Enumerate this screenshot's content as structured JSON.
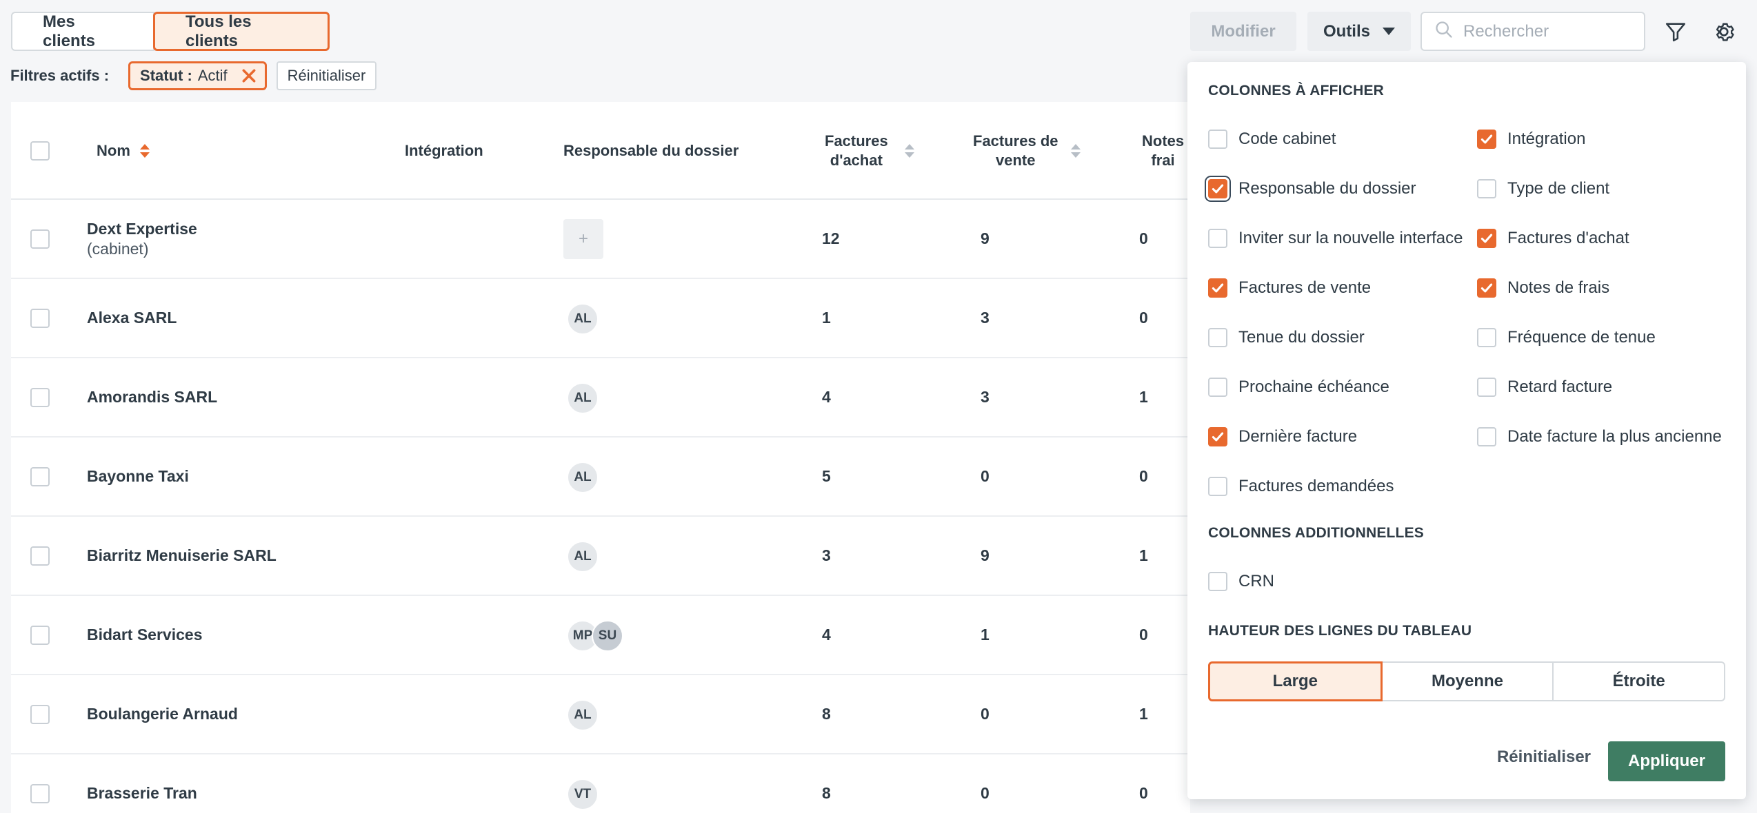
{
  "tabs": {
    "mine": "Mes clients",
    "all": "Tous les clients"
  },
  "toolbar": {
    "edit_label": "Modifier",
    "tools_label": "Outils",
    "search_placeholder": "Rechercher",
    "icons": [
      "search-icon",
      "filter-icon",
      "gear-icon",
      "chevron-down-icon"
    ]
  },
  "filters": {
    "label": "Filtres actifs :",
    "chip_key": "Statut :",
    "chip_value": "Actif",
    "reset_label": "Réinitialiser"
  },
  "table": {
    "headers": {
      "name": "Nom",
      "integration": "Intégration",
      "owner": "Responsable du dossier",
      "purchase_l1": "Factures",
      "purchase_l2": "d'achat",
      "sales_l1": "Factures de",
      "sales_l2": "vente",
      "expenses_l1": "Notes",
      "expenses_l2": "frai"
    },
    "rows": [
      {
        "name": "Dext Expertise",
        "sub": "(cabinet)",
        "avatars": [],
        "add_label": "+",
        "purchase": "12",
        "sales": "9",
        "expenses": "0"
      },
      {
        "name": "Alexa SARL",
        "avatars": [
          "AL"
        ],
        "purchase": "1",
        "sales": "3",
        "expenses": "0"
      },
      {
        "name": "Amorandis SARL",
        "avatars": [
          "AL"
        ],
        "purchase": "4",
        "sales": "3",
        "expenses": "1"
      },
      {
        "name": "Bayonne Taxi",
        "avatars": [
          "AL"
        ],
        "purchase": "5",
        "sales": "0",
        "expenses": "0"
      },
      {
        "name": "Biarritz Menuiserie SARL",
        "avatars": [
          "AL"
        ],
        "purchase": "3",
        "sales": "9",
        "expenses": "1"
      },
      {
        "name": "Bidart Services",
        "avatars": [
          "MP",
          "SU"
        ],
        "purchase": "4",
        "sales": "1",
        "expenses": "0"
      },
      {
        "name": "Boulangerie Arnaud",
        "avatars": [
          "AL"
        ],
        "purchase": "8",
        "sales": "0",
        "expenses": "1"
      },
      {
        "name": "Brasserie Tran",
        "avatars": [
          "VT"
        ],
        "purchase": "8",
        "sales": "0",
        "expenses": "0"
      }
    ]
  },
  "panel": {
    "columns_title": "COLONNES À AFFICHER",
    "columns": [
      {
        "label": "Code cabinet",
        "checked": false
      },
      {
        "label": "Intégration",
        "checked": true
      },
      {
        "label": "Responsable du dossier",
        "checked": true,
        "focused": true
      },
      {
        "label": "Type de client",
        "checked": false
      },
      {
        "label": "Inviter sur la nouvelle interface",
        "checked": false
      },
      {
        "label": "Factures d'achat",
        "checked": true
      },
      {
        "label": "Factures de vente",
        "checked": true
      },
      {
        "label": "Notes de frais",
        "checked": true
      },
      {
        "label": "Tenue du dossier",
        "checked": false
      },
      {
        "label": "Fréquence de tenue",
        "checked": false
      },
      {
        "label": "Prochaine échéance",
        "checked": false
      },
      {
        "label": "Retard facture",
        "checked": false
      },
      {
        "label": "Dernière facture",
        "checked": true
      },
      {
        "label": "Date facture la plus ancienne",
        "checked": false
      },
      {
        "label": "Factures demandées",
        "checked": false
      }
    ],
    "additional_title": "COLONNES ADDITIONNELLES",
    "additional": [
      {
        "label": "CRN",
        "checked": false
      }
    ],
    "height_title": "HAUTEUR DES LIGNES DU TABLEAU",
    "heights": [
      "Large",
      "Moyenne",
      "Étroite"
    ],
    "height_selected": "Large",
    "reset_label": "Réinitialiser",
    "apply_label": "Appliquer"
  },
  "colors": {
    "accent": "#e8692e",
    "accent_bg": "#fdeee3",
    "apply": "#3f7d63"
  }
}
